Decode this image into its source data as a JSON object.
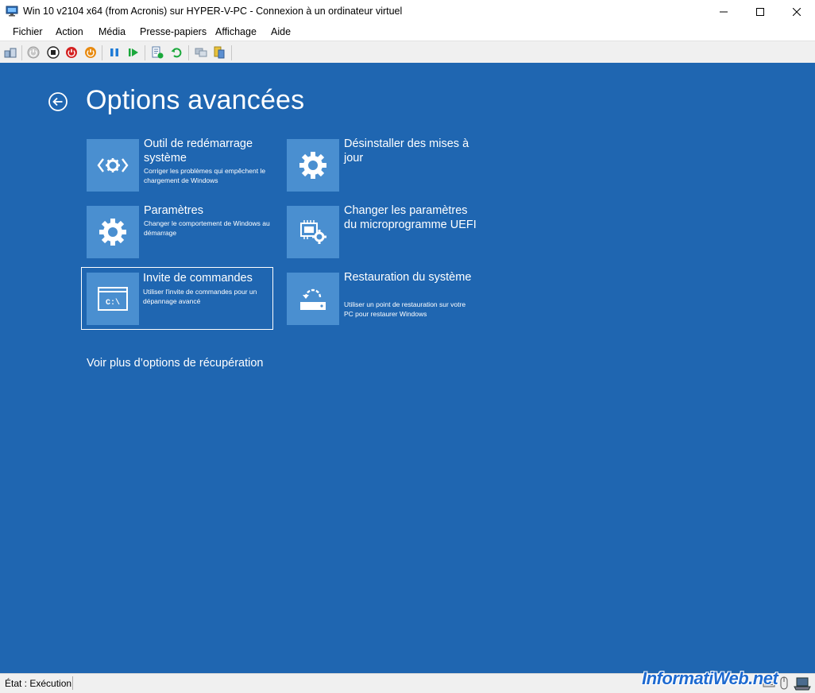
{
  "window": {
    "title": "Win 10 v2104 x64 (from Acronis) sur HYPER-V-PC - Connexion à un ordinateur virtuel",
    "controls": [
      "minimize-icon",
      "maximize-icon",
      "close-icon"
    ]
  },
  "menu": [
    "Fichier",
    "Action",
    "Média",
    "Presse-papiers",
    "Affichage",
    "Aide"
  ],
  "toolbar": {
    "buttons": [
      "ctrl-alt-del-icon",
      "start-icon",
      "turn-off-icon",
      "shutdown-icon",
      "save-icon",
      "pause-icon",
      "resume-icon",
      "checkpoint-icon",
      "revert-icon",
      "enhanced-session-icon",
      "share-icon"
    ],
    "colors": {
      "stop": "#d42020",
      "shutdown": "#e88a10",
      "pause": "#1f7bd6",
      "resume": "#1aa83b"
    }
  },
  "screen": {
    "background": "#1f66b1",
    "tile_color": "#4a8fd0",
    "title": "Options avancées",
    "tiles": [
      {
        "icon": "startup-repair-icon",
        "title": "Outil de redémarrage système",
        "desc": "Corriger les problèmes qui empêchent le chargement de Windows"
      },
      {
        "icon": "uninstall-updates-icon",
        "title": "Désinstaller des mises à jour",
        "desc": ""
      },
      {
        "icon": "startup-settings-icon",
        "title": "Paramètres",
        "desc": "Changer le comportement de Windows au démarrage"
      },
      {
        "icon": "uefi-firmware-icon",
        "title": "Changer les paramètres du microprogramme UEFI",
        "desc": ""
      },
      {
        "icon": "command-prompt-icon",
        "title": "Invite de commandes",
        "desc": "Utiliser l'invite de commandes pour un dépannage avancé",
        "icon_text": "C:\\",
        "selected": true
      },
      {
        "icon": "system-restore-icon",
        "title": "Restauration du système",
        "desc": "Utiliser un point de restauration sur votre PC pour restaurer Windows"
      }
    ],
    "more_options": "Voir plus d’options de récupération"
  },
  "status": {
    "text": "État : Exécution",
    "watermark": "InformatiWeb.net"
  }
}
